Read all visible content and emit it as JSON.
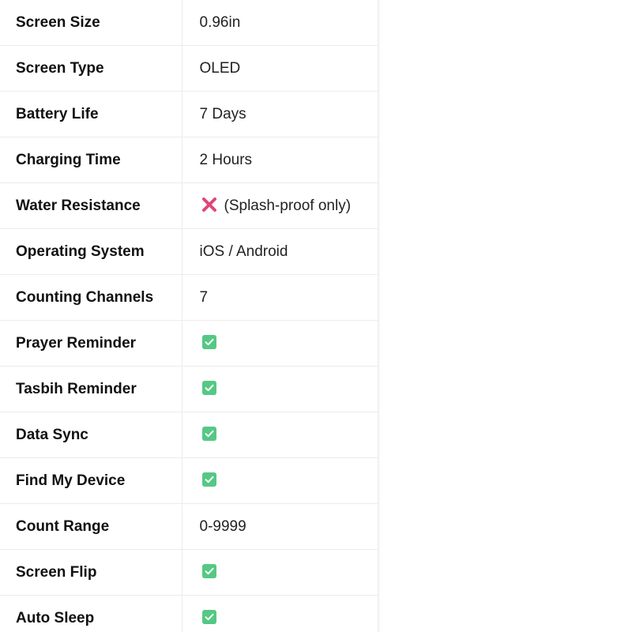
{
  "specs": [
    {
      "label": "Screen Size",
      "value": "0.96in"
    },
    {
      "label": "Screen Type",
      "value": "OLED"
    },
    {
      "label": "Battery Life",
      "value": "7 Days"
    },
    {
      "label": "Charging Time",
      "value": "2 Hours"
    },
    {
      "label": "Water Resistance",
      "value": "(Splash-proof only)",
      "icon": "cross-icon"
    },
    {
      "label": "Operating System",
      "value": "iOS / Android"
    },
    {
      "label": "Counting Channels",
      "value": "7"
    },
    {
      "label": "Prayer Reminder",
      "icon": "check-icon"
    },
    {
      "label": "Tasbih Reminder",
      "icon": "check-icon"
    },
    {
      "label": "Data Sync",
      "icon": "check-icon"
    },
    {
      "label": "Find My Device",
      "icon": "check-icon"
    },
    {
      "label": "Count Range",
      "value": "0-9999"
    },
    {
      "label": "Screen Flip",
      "icon": "check-icon"
    },
    {
      "label": "Auto Sleep",
      "icon": "check-icon"
    }
  ],
  "colors": {
    "check": "#55c884",
    "cross": "#e0457b",
    "border": "#ececec"
  }
}
